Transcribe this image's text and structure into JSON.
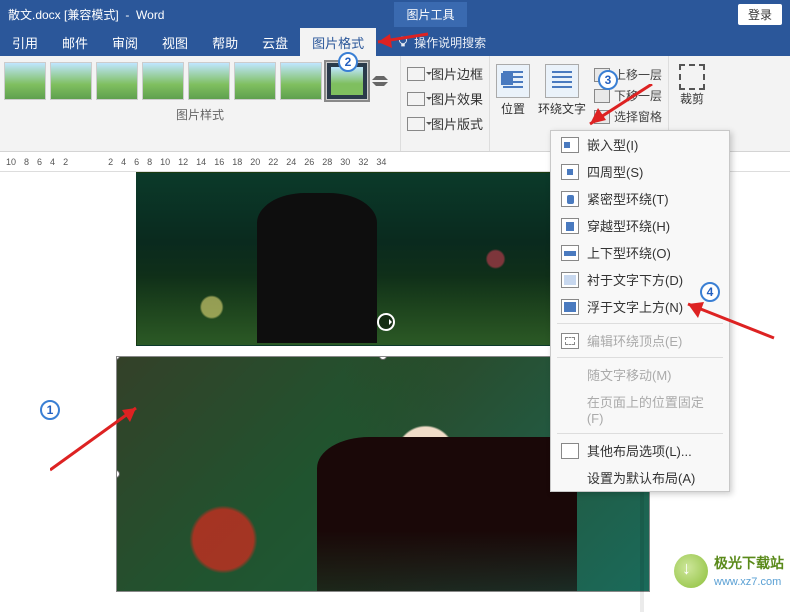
{
  "titlebar": {
    "doc_name": "散文.docx [兼容模式]",
    "app_name": "Word",
    "tool_tab": "图片工具",
    "login": "登录"
  },
  "tabs": {
    "items": [
      "引用",
      "邮件",
      "审阅",
      "视图",
      "帮助",
      "云盘",
      "图片格式"
    ],
    "active_index": 6,
    "search_placeholder": "操作说明搜索"
  },
  "ribbon": {
    "styles_label": "图片样式",
    "format": {
      "border": "图片边框",
      "effects": "图片效果",
      "layout": "图片版式"
    },
    "position": "位置",
    "wrap": "环绕文字",
    "arrange": {
      "bring_forward": "上移一层",
      "send_backward": "下移一层",
      "selection_pane": "选择窗格"
    },
    "crop": "裁剪"
  },
  "ruler": {
    "left_marks": [
      "10",
      "8",
      "6",
      "4",
      "2"
    ],
    "right_marks": [
      "2",
      "4",
      "6",
      "8",
      "10",
      "12",
      "14",
      "16",
      "18",
      "20",
      "22",
      "24",
      "26",
      "28",
      "30",
      "32",
      "34"
    ]
  },
  "dropdown": {
    "items": [
      {
        "label": "嵌入型(I)",
        "icon": "inline",
        "enabled": true,
        "u": "I"
      },
      {
        "label": "四周型(S)",
        "icon": "square",
        "enabled": true,
        "u": "S"
      },
      {
        "label": "紧密型环绕(T)",
        "icon": "tight",
        "enabled": true,
        "u": "T"
      },
      {
        "label": "穿越型环绕(H)",
        "icon": "through",
        "enabled": true,
        "u": "H"
      },
      {
        "label": "上下型环绕(O)",
        "icon": "topbot",
        "enabled": true,
        "u": "O"
      },
      {
        "label": "衬于文字下方(D)",
        "icon": "behind",
        "enabled": true,
        "u": "D"
      },
      {
        "label": "浮于文字上方(N)",
        "icon": "front",
        "enabled": true,
        "u": "N"
      }
    ],
    "edit_points": "编辑环绕顶点(E)",
    "move_with_text": "随文字移动(M)",
    "fix_on_page": "在页面上的位置固定(F)",
    "more_options": "其他布局选项(L)...",
    "set_default": "设置为默认布局(A)"
  },
  "annotations": {
    "m1": "1",
    "m2": "2",
    "m3": "3",
    "m4": "4"
  },
  "watermark": {
    "name": "极光下载站",
    "url": "www.xz7.com"
  }
}
